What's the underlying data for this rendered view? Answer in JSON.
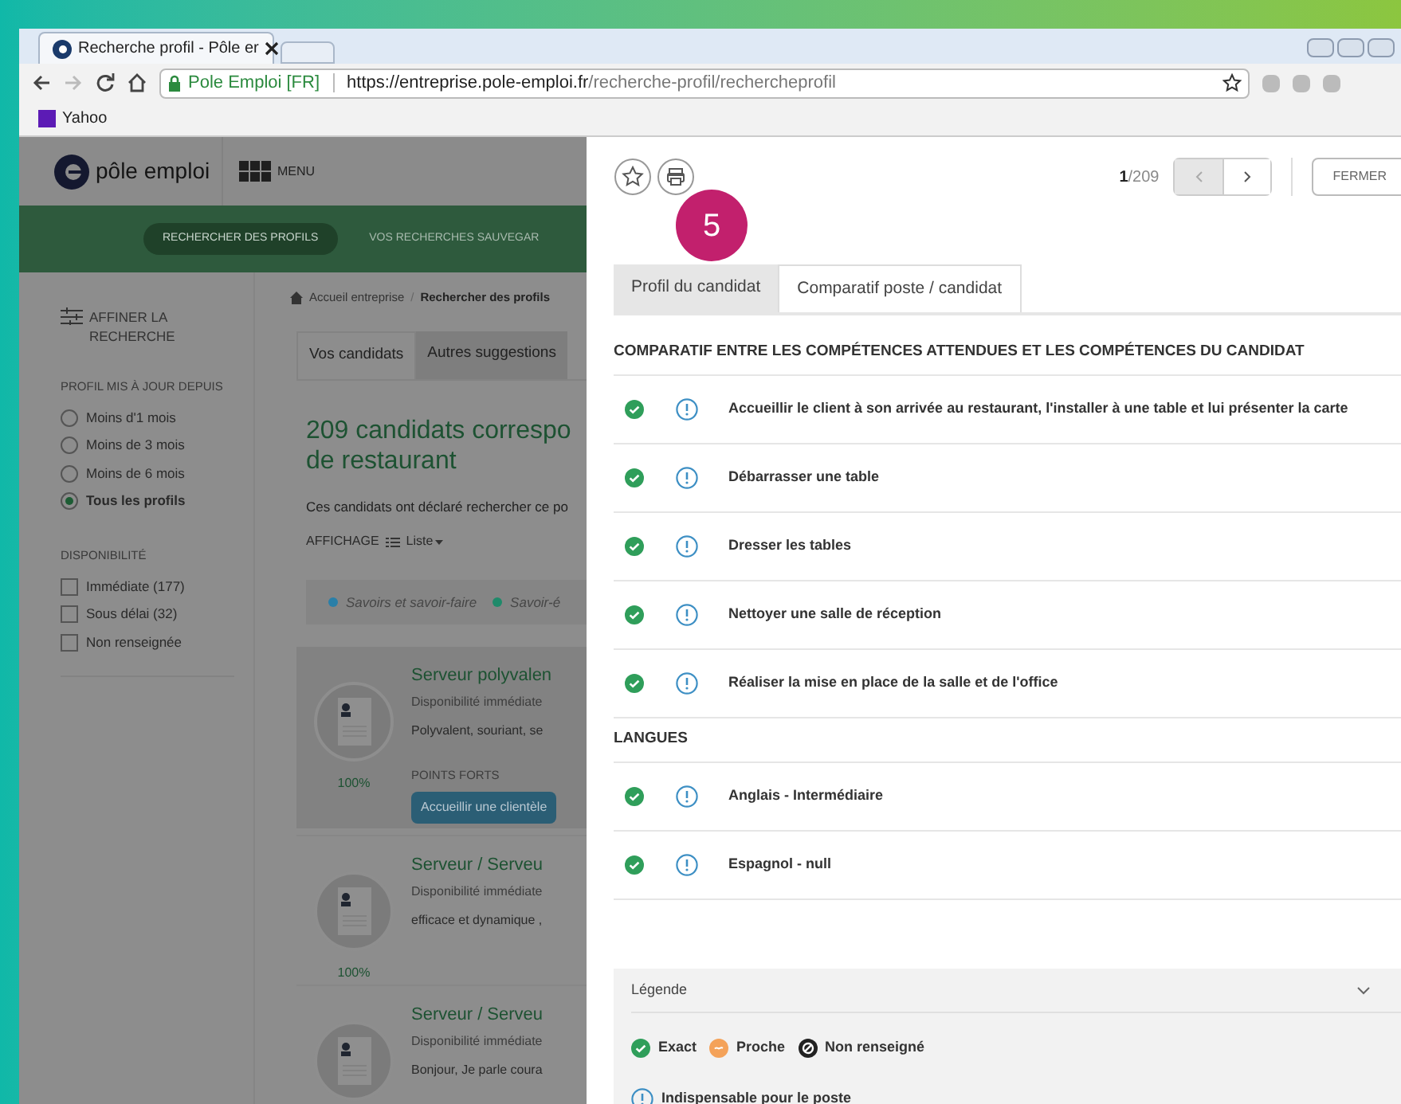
{
  "browser": {
    "tab_title": "Recherche profil - Pôle er",
    "secure_label": "Pole Emploi [FR]",
    "url_host": "https://entreprise.pole-emploi.fr",
    "url_path": "/recherche-profil/rechercheprofil",
    "bookmarks": [
      "Yahoo"
    ]
  },
  "site": {
    "logo_text": "pôle emploi",
    "menu_label": "MENU",
    "nav": [
      {
        "label": "RECHERCHER DES PROFILS",
        "selected": true
      },
      {
        "label": "VOS RECHERCHES SAUVEGAR",
        "selected": false
      }
    ],
    "breadcrumb": [
      "Accueil entreprise",
      "Rechercher des profils"
    ],
    "breadcrumb_separator": "/",
    "sidebar": {
      "title": "AFFINER LA RECHERCHE",
      "groups": [
        {
          "title": "PROFIL MIS À JOUR DEPUIS",
          "kind": "radio",
          "options": [
            {
              "label": "Moins d'1 mois",
              "selected": false
            },
            {
              "label": "Moins de 3 mois",
              "selected": false
            },
            {
              "label": "Moins de 6 mois",
              "selected": false
            },
            {
              "label": "Tous les profils",
              "selected": true
            }
          ]
        },
        {
          "title": "DISPONIBILITÉ",
          "kind": "checkbox",
          "options": [
            {
              "label": "Immédiate (177)",
              "checked": false
            },
            {
              "label": "Sous délai (32)",
              "checked": false
            },
            {
              "label": "Non renseignée",
              "checked": false
            }
          ]
        }
      ]
    },
    "tabs": [
      {
        "label": "Vos candidats",
        "selected": true
      },
      {
        "label": "Autres suggestions",
        "selected": false
      }
    ],
    "heading_lines": [
      "209 candidats correspo",
      "de restaurant"
    ],
    "description": "Ces candidats ont déclaré rechercher ce po",
    "display_label": "AFFICHAGE",
    "display_value": "Liste",
    "legend": [
      {
        "label": "Savoirs et savoir-faire",
        "color": "#2a7fa8"
      },
      {
        "label": "Savoir-é",
        "color": "#1f8a6a"
      }
    ],
    "candidates": [
      {
        "title": "Serveur polyvalen",
        "availability": "Disponibilité immédiate",
        "summary": "Polyvalent, souriant, se",
        "score": "100%",
        "highlighted": true,
        "strengths_label": "POINTS FORTS",
        "strength": "Accueillir une clientèle"
      },
      {
        "title": "Serveur / Serveu",
        "availability": "Disponibilité immédiate",
        "summary": "efficace et dynamique ,",
        "score": "100%",
        "highlighted": false
      },
      {
        "title": "Serveur / Serveu",
        "availability": "Disponibilité immédiate",
        "summary": "Bonjour, Je parle coura",
        "highlighted": false
      }
    ]
  },
  "panel": {
    "page_current": "1",
    "page_total": "/209",
    "close_label": "FERMER",
    "step_badge": "5",
    "tabs": [
      {
        "label": "Profil du candidat",
        "selected": false
      },
      {
        "label": "Comparatif poste / candidat",
        "selected": true
      }
    ],
    "sections": [
      {
        "title": "COMPARATIF ENTRE LES COMPÉTENCES ATTENDUES ET LES COMPÉTENCES DU CANDIDAT",
        "items": [
          {
            "label": "Accueillir le client à son arrivée au restaurant, l'installer à une table et lui présenter la carte",
            "kind": "exact",
            "required": true
          },
          {
            "label": "Débarrasser une table",
            "kind": "exact",
            "required": true
          },
          {
            "label": "Dresser les tables",
            "kind": "exact",
            "required": true
          },
          {
            "label": "Nettoyer une salle de réception",
            "kind": "exact",
            "required": true
          },
          {
            "label": "Réaliser la mise en place de la salle et de l'office",
            "kind": "exact",
            "required": true
          }
        ]
      },
      {
        "title": "LANGUES",
        "items": [
          {
            "label": "Anglais - Intermédiaire",
            "kind": "exact",
            "required": true
          },
          {
            "label": "Espagnol - null",
            "kind": "exact",
            "required": true
          }
        ]
      }
    ],
    "legend": {
      "title": "Légende",
      "expanded": true,
      "items": [
        {
          "label": "Exact",
          "kind": "exact"
        },
        {
          "label": "Proche",
          "kind": "close"
        },
        {
          "label": "Non renseigné",
          "kind": "unknown"
        }
      ],
      "required_label": "Indispensable pour le poste"
    }
  }
}
